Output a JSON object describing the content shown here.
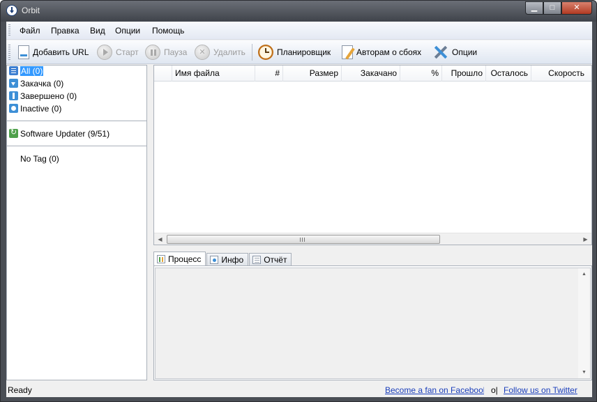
{
  "window": {
    "title": "Orbit",
    "minimize": "▁",
    "maximize": "□",
    "close": "✕"
  },
  "menu": [
    "Файл",
    "Правка",
    "Вид",
    "Опции",
    "Помощь"
  ],
  "toolbar": {
    "add_url": "Добавить URL",
    "start": "Старт",
    "pause": "Пауза",
    "delete": "Удалить",
    "scheduler": "Планировщик",
    "to_authors": "Авторам о сбоях",
    "options": "Опции"
  },
  "categories": [
    {
      "label": "All (0)",
      "icon": "list-icon"
    },
    {
      "label": "Закачка (0)",
      "icon": "download-icon"
    },
    {
      "label": "Завершено (0)",
      "icon": "completed-icon"
    },
    {
      "label": "Inactive (0)",
      "icon": "inactive-icon"
    }
  ],
  "software_updater": {
    "label": "Software Updater (9/51)",
    "icon": "refresh-icon"
  },
  "tags": {
    "label": "No Tag (0)"
  },
  "columns": [
    "",
    "Имя файла",
    "#",
    "Размер",
    "Закачано",
    "%",
    "Прошло",
    "Осталось",
    "Скорость"
  ],
  "rows": [],
  "tabs": [
    {
      "label": "Процесс",
      "icon": "progress-chart-icon"
    },
    {
      "label": "Инфо",
      "icon": "info-icon"
    },
    {
      "label": "Отчёт",
      "icon": "log-icon"
    }
  ],
  "status": {
    "text": "Ready",
    "facebook_link": "Become a fan on Facebook",
    "separator": "o|",
    "twitter_link": "Follow us on Twitter"
  },
  "colors": {
    "selection": "#3399ff",
    "link": "#1a3ebb",
    "title_bar": "#4a4e55"
  }
}
